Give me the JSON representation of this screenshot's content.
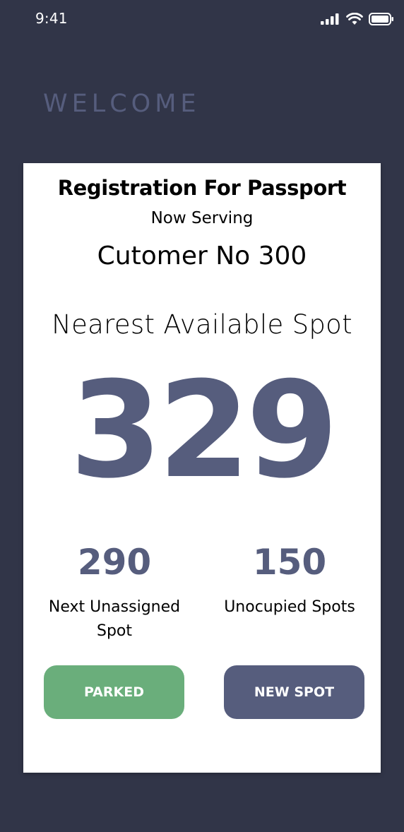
{
  "status_bar": {
    "time": "9:41",
    "icons": [
      "cellular-signal-icon",
      "wifi-icon",
      "battery-icon"
    ]
  },
  "header": {
    "welcome": "WELCOME"
  },
  "card": {
    "title": "Registration For Passport",
    "now_serving_label": "Now Serving",
    "customer": "Cutomer No 300",
    "nearest_label": "Nearest Available Spot",
    "nearest_value": "329",
    "stats": [
      {
        "value": "290",
        "label": "Next Unassigned Spot"
      },
      {
        "value": "150",
        "label": "Unocupied Spots"
      }
    ],
    "buttons": {
      "parked": "PARKED",
      "new_spot": "NEW SPOT"
    }
  },
  "colors": {
    "background": "#313548",
    "accent": "#565d7d",
    "parked_button": "#6aae7b",
    "card": "#ffffff"
  }
}
